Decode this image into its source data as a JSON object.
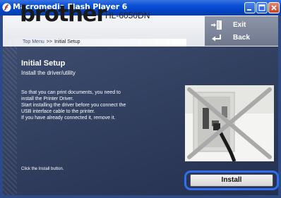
{
  "window": {
    "title": "Macromedia Flash Player 6"
  },
  "header": {
    "logo": "brother",
    "model": "HL-6050DN",
    "breadcrumb": {
      "root": "Top Menu",
      "separator": ">>",
      "current": "Initial Setup"
    },
    "nav": {
      "exit_label": "Exit",
      "back_label": "Back"
    }
  },
  "content": {
    "heading": "Initial Setup",
    "subheading": "Install the driver/utility",
    "paragraph": [
      "So that you can print documents, you need to",
      "install the Printer Driver.",
      "Start installing the driver before you connect the",
      "USB interface cable to the printer.",
      "If you have already connected it, remove it."
    ],
    "hint": "Click the Install button.",
    "install_label": "Install"
  },
  "colors": {
    "titlebar": "#0a52d8",
    "content_bg": "#2e3b5c",
    "highlight_ring": "#2f6ef0"
  },
  "icons": {
    "app": "flash-player-icon",
    "minimize": "minimize-icon",
    "maximize": "maximize-icon",
    "close": "close-icon",
    "exit": "exit-door-icon",
    "back": "back-arrow-icon"
  }
}
